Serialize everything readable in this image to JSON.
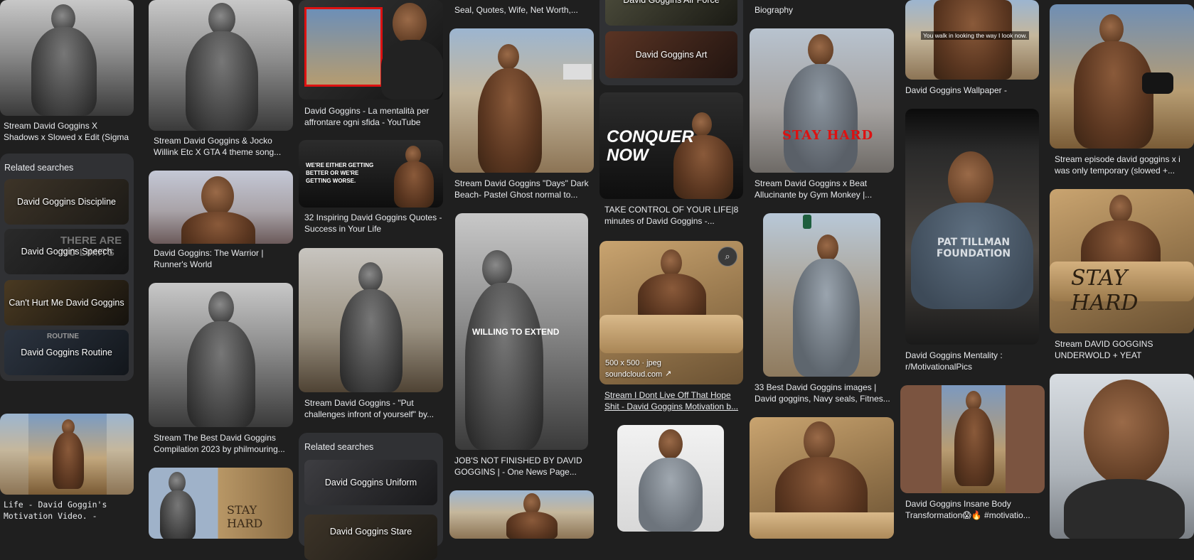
{
  "col1": {
    "item1_caption": "Stream David Goggins X Shadows x Slowed x Edit (Sigma Far's track...",
    "related_title": "Related searches",
    "chips": [
      "David Goggins Discipline",
      "David Goggins Speech",
      "Can't Hurt Me David Goggins",
      "David Goggins Routine"
    ],
    "chip2_overlay": "THERE ARE NO LIMITS",
    "chip4_overlay": "ROUTINE",
    "item3_caption": "Life - David Goggin's Motivation Video. - YouTube"
  },
  "col2": {
    "item1_caption": "Stream David Goggins & Jocko Willink Etc X GTA 4 theme song...",
    "item2_caption": "David Goggins: The Warrior | Runner's World",
    "item3_caption": "Stream The Best David Goggins Compilation 2023 by philmouring...",
    "item4_overlay": "STAY HARD"
  },
  "col3": {
    "item1_caption": "David Goggins - La mentalità per affrontare ogni sfida - YouTube",
    "item2_caption": "32 Inspiring David Goggins Quotes - Success in Your Life",
    "item2_overlay": "WE'RE EITHER GETTING BETTER OR WE'RE GETTING WORSE.",
    "item3_caption": "Stream David Goggins - \"Put challenges infront of yourself\" by...",
    "related_title": "Related searches",
    "chips": [
      "David Goggins Uniform",
      "David Goggins Stare"
    ]
  },
  "col4": {
    "top_caption": "Seal, Quotes, Wife, Net Worth,...",
    "item1_caption": "Stream David Goggins \"Days\" Dark Beach- Pastel Ghost normal to...",
    "item2_overlay": "WILLING TO EXTEND",
    "item2_caption": "JOB'S NOT FINISHED BY DAVID GOGGINS | - One News Page..."
  },
  "col5": {
    "chip_top": "David Goggins Air Force",
    "chip_art": "David Goggins Art",
    "item1_overlay": "CONQUER NOW",
    "item1_caption": "TAKE CONTROL OF YOUR LIFE|8 minutes of David Goggins -...",
    "item2_size": "500 x 500 · jpeg",
    "item2_source": "soundcloud.com",
    "item2_caption": "Stream I Dont Live Off That Hope Shit - David Goggins Motivation b..."
  },
  "col6": {
    "top_caption": "Biography",
    "item1_overlay": "STAY HARD",
    "item1_caption": "Stream David Goggins x Beat Allucinante by Gym Monkey |...",
    "item2_caption": "33 Best David Goggins images | David goggins, Navy seals, Fitnes..."
  },
  "col7": {
    "item1_overlay": "You walk in looking the way I look now.",
    "item1_caption": "David Goggins Wallpaper - IXpaper",
    "item2_overlay": "PAT TILLMAN FOUNDATION",
    "item2_caption": "David Goggins Mentality : r/MotivationalPics",
    "item3_caption": "David Goggins Insane Body Transformation😱🔥 #motivatio..."
  },
  "col8": {
    "item1_caption": "Stream episode david goggins x i was only temporary (slowed +...",
    "item2_overlay": "STAY HARD",
    "item2_caption": "Stream DAVID GOGGINS UNDERWOLD + YEAT FLAWLESS..."
  }
}
